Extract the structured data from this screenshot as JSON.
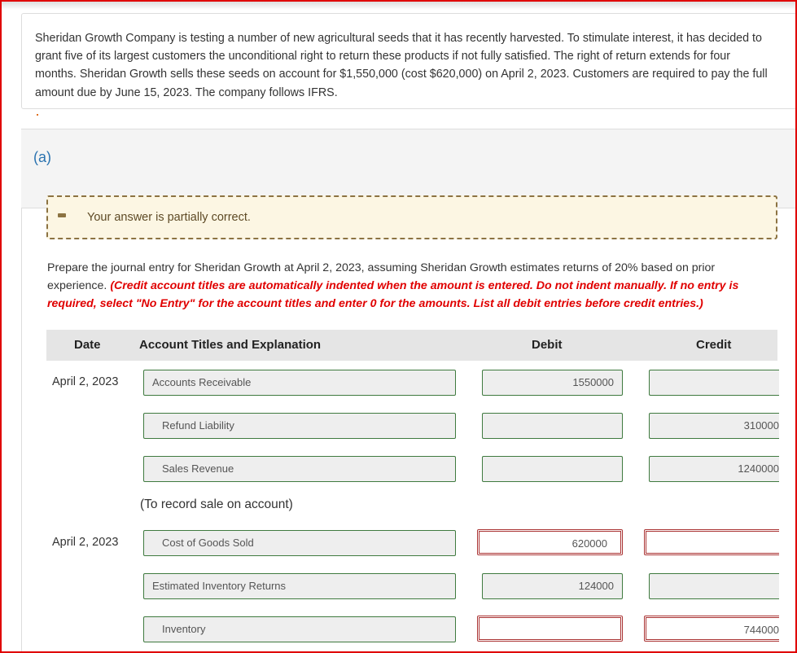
{
  "problem": {
    "text": "Sheridan Growth Company is testing a number of new agricultural seeds that it has recently harvested. To stimulate interest, it has decided to grant five of its largest customers the unconditional right to return these products if not fully satisfied. The right of return extends for four months. Sheridan Growth sells these seeds on account for $1,550,000 (cost $620,000) on April 2, 2023. Customers are required to pay the full amount due by June 15, 2023. The company follows IFRS."
  },
  "part": {
    "label": "(a)"
  },
  "feedback": {
    "status": "partial",
    "icon": "minus-icon",
    "message": "Your answer is partially correct."
  },
  "instructions": {
    "text": "Prepare the journal entry for Sheridan Growth at April 2, 2023, assuming Sheridan Growth estimates returns of 20% based on prior experience.",
    "note": "(Credit account titles are automatically indented when the amount is entered. Do not indent manually. If no entry is required, select \"No Entry\" for the account titles and enter 0 for the amounts. List all debit entries before credit entries.)"
  },
  "table": {
    "headers": {
      "date": "Date",
      "account": "Account Titles and Explanation",
      "debit": "Debit",
      "credit": "Credit"
    },
    "entries": [
      {
        "date": "April 2, 2023",
        "rows": [
          {
            "account": "Accounts Receivable",
            "debit": "1550000",
            "credit": "",
            "account_status": "correct",
            "debit_status": "correct",
            "credit_status": "correct"
          },
          {
            "account": "Refund Liability",
            "debit": "",
            "credit": "310000",
            "account_status": "correct",
            "debit_status": "correct",
            "credit_status": "correct"
          },
          {
            "account": "Sales Revenue",
            "debit": "",
            "credit": "1240000",
            "account_status": "correct",
            "debit_status": "correct",
            "credit_status": "correct"
          }
        ],
        "explanation": "(To record sale on account)"
      },
      {
        "date": "April 2, 2023",
        "rows": [
          {
            "account": "Cost of Goods Sold",
            "debit": "620000",
            "credit": "",
            "account_status": "correct",
            "debit_status": "incorrect",
            "credit_status": "incorrect"
          },
          {
            "account": "Estimated Inventory Returns",
            "debit": "124000",
            "credit": "",
            "account_status": "correct",
            "debit_status": "correct",
            "credit_status": "correct"
          },
          {
            "account": "Inventory",
            "debit": "",
            "credit": "744000",
            "account_status": "correct",
            "debit_status": "incorrect",
            "credit_status": "incorrect"
          }
        ]
      }
    ]
  }
}
